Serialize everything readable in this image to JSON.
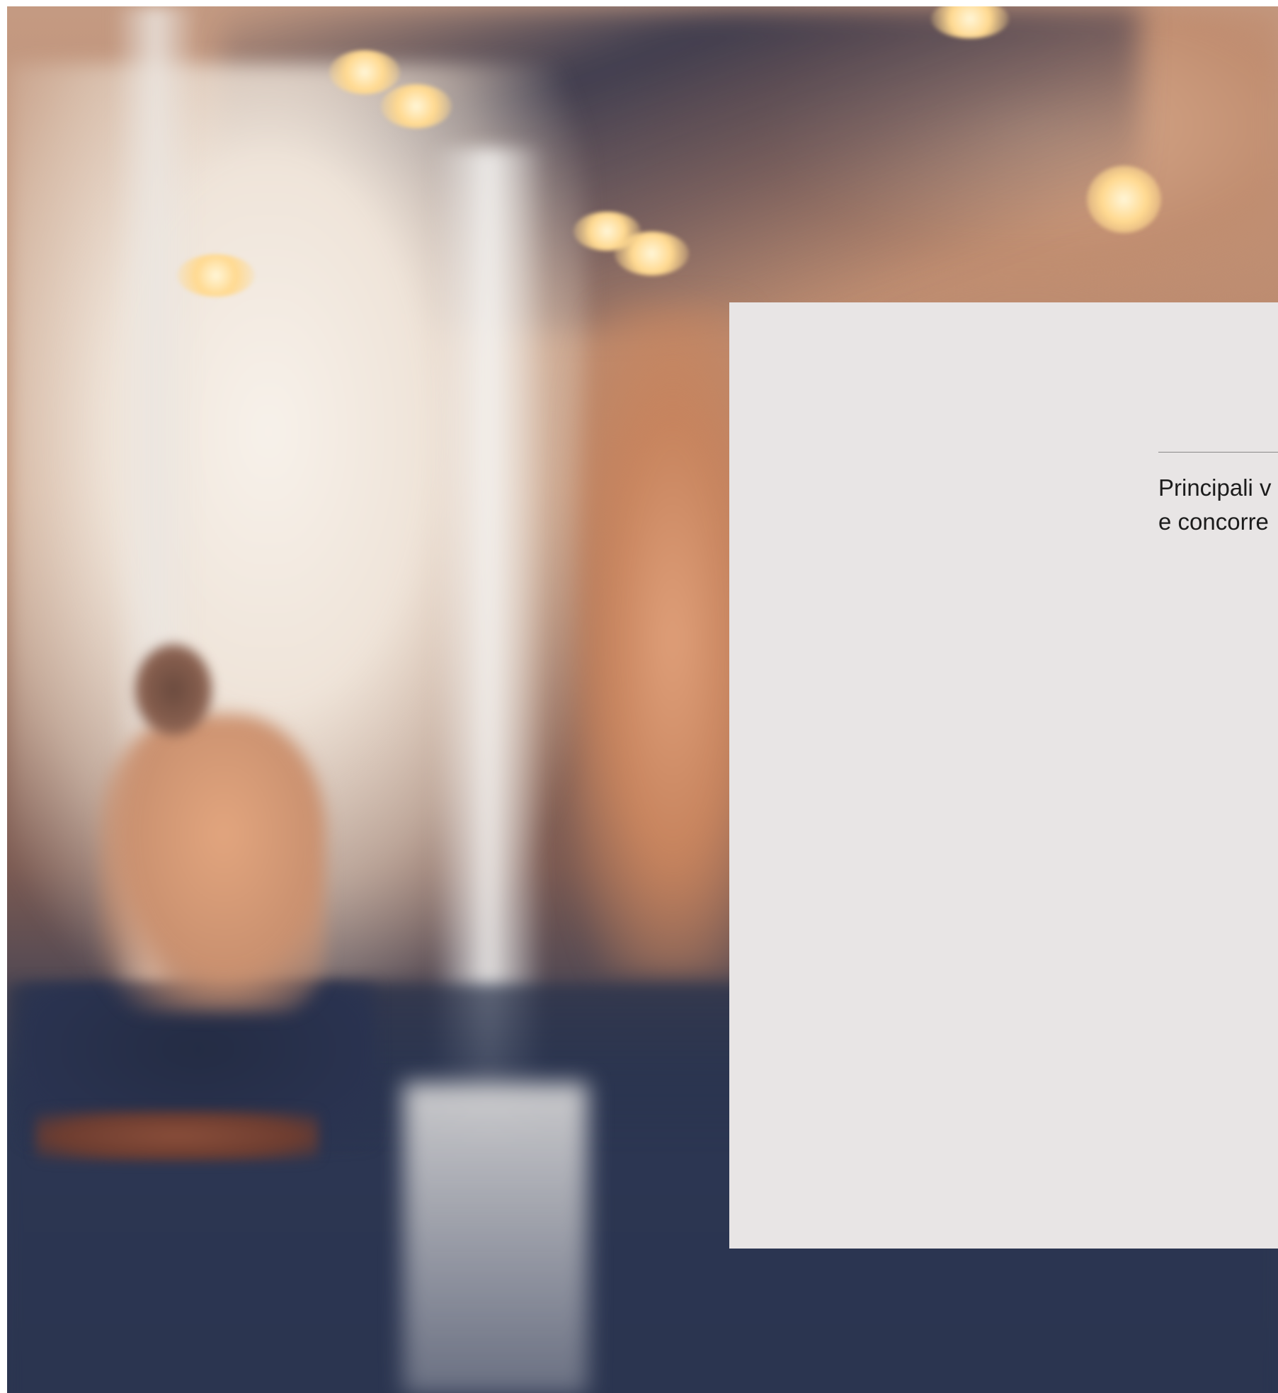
{
  "background": {
    "description_icon": "blurred-cafe-photo"
  },
  "panel": {
    "heading_line_1": "Principali v",
    "heading_line_2": "e concorre",
    "background_color": "#e8e5e5"
  }
}
